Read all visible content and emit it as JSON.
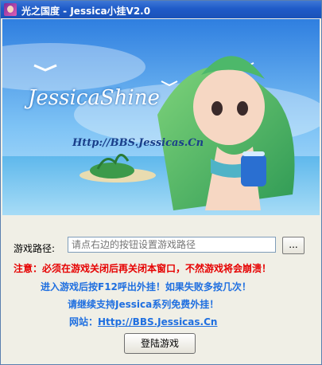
{
  "window": {
    "title": "光之国度 - Jessica小挂V2.0",
    "icon": "app-icon"
  },
  "banner": {
    "logo_text": "JessicaShine",
    "url_text": "Http://BBS.Jessicas.Cn"
  },
  "form": {
    "path_label": "游戏路径:",
    "path_placeholder": "请点右边的按钮设置游戏路径",
    "browse_label": "..."
  },
  "notices": {
    "warning": "注意：必须在游戏关闭后再关闭本窗口，不然游戏将会崩溃！",
    "hint": "进入游戏后按F12呼出外挂！如果失败多按几次！",
    "support": "请继续支持Jessica系列免费外挂！",
    "site_label": "网站：",
    "site_link": "Http://BBS.Jessicas.Cn"
  },
  "actions": {
    "login_label": "登陆游戏"
  },
  "colors": {
    "titlebar": "#1f5bc8",
    "warning": "#e60000",
    "info": "#1f6fe0"
  }
}
